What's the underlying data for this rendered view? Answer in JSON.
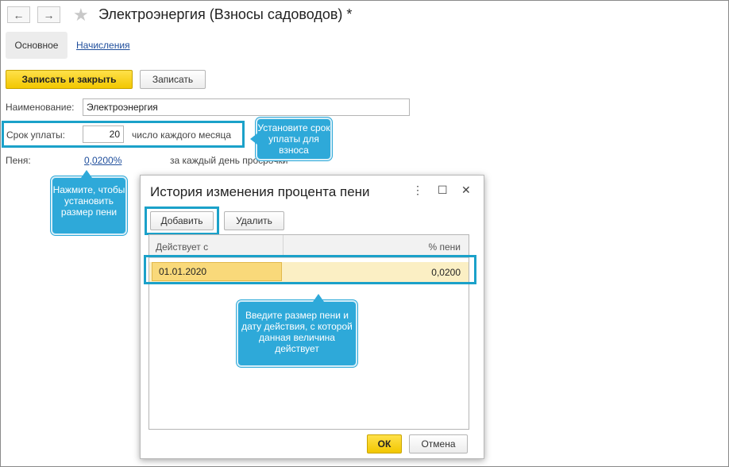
{
  "window": {
    "title": "Электроэнергия (Взносы садоводов) *",
    "back_icon": "←",
    "forward_icon": "→",
    "star_icon": "★"
  },
  "tabs": [
    {
      "label": "Основное",
      "active": true
    },
    {
      "label": "Начисления",
      "active": false
    }
  ],
  "toolbar": {
    "save_close_label": "Записать и закрыть",
    "save_label": "Записать"
  },
  "form": {
    "name_label": "Наименование:",
    "name_value": "Электроэнергия",
    "due_label": "Срок уплаты:",
    "due_value": "20",
    "due_suffix": "число каждого месяца",
    "penalty_label": "Пеня:",
    "penalty_value": "0,0200%",
    "penalty_suffix": "за каждый день просрочки"
  },
  "callouts": {
    "due": "Установите срок уплаты для взноса",
    "penalty": "Нажмите, чтобы установить размер пени",
    "grid": "Введите размер пени и дату действия, с которой данная величина действует"
  },
  "dialog": {
    "title": "История изменения процента пени",
    "more_icon": "⋮",
    "maximize_icon": "☐",
    "close_icon": "✕",
    "add_label": "Добавить",
    "delete_label": "Удалить",
    "columns": [
      "Действует с",
      "% пени"
    ],
    "rows": [
      {
        "date": "01.01.2020",
        "rate": "0,0200"
      }
    ],
    "ok_label": "ОК",
    "cancel_label": "Отмена"
  },
  "colors": {
    "accent_highlight": "#1ba1c9",
    "callout_bg": "#2ea9d9",
    "primary_button": "#f2c700",
    "link": "#1f4e9c",
    "selected_row": "#fbefc4"
  }
}
